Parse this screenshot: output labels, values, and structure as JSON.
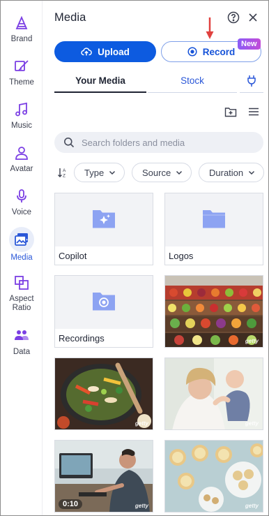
{
  "sidebar": {
    "items": [
      {
        "label": "Brand",
        "icon": "brand-icon"
      },
      {
        "label": "Theme",
        "icon": "theme-icon"
      },
      {
        "label": "Music",
        "icon": "music-icon"
      },
      {
        "label": "Avatar",
        "icon": "avatar-icon"
      },
      {
        "label": "Voice",
        "icon": "voice-icon"
      },
      {
        "label": "Media",
        "icon": "media-icon",
        "active": true
      },
      {
        "label": "Aspect\nRatio",
        "icon": "aspect-ratio-icon"
      },
      {
        "label": "Data",
        "icon": "data-icon"
      }
    ],
    "aspect_line1": "Aspect",
    "aspect_line2": "Ratio"
  },
  "panel": {
    "title": "Media",
    "help_icon": "help-icon",
    "close_icon": "close-icon",
    "upload_label": "Upload",
    "record_label": "Record",
    "new_badge": "New",
    "tabs": {
      "your_media": "Your Media",
      "stock": "Stock"
    },
    "search_placeholder": "Search folders and media",
    "filters": {
      "type": "Type",
      "source": "Source",
      "duration": "Duration"
    },
    "folders": [
      {
        "name": "Copilot"
      },
      {
        "name": "Logos"
      },
      {
        "name": "Recordings"
      }
    ],
    "media": [
      {
        "watermark": "getty",
        "subject": "produce market stall"
      },
      {
        "watermark": "getty",
        "subject": "vegetable stir fry"
      },
      {
        "watermark": "getty",
        "subject": "mother and child"
      },
      {
        "watermark": "getty",
        "subject": "person at computer",
        "duration": "0:10"
      },
      {
        "watermark": "getty",
        "subject": "tarts on plates"
      }
    ]
  },
  "colors": {
    "accent": "#0d5be0",
    "active_bg": "#e8edf9",
    "icon_purple": "#7b3fe4",
    "arrow": "#e0413f"
  }
}
